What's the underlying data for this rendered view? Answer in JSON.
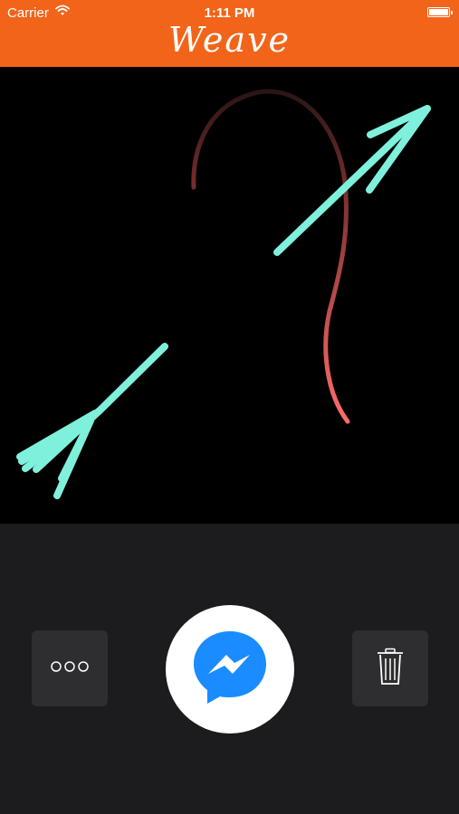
{
  "status_bar": {
    "carrier": "Carrier",
    "time": "1:11 PM"
  },
  "header": {
    "title": "Weave",
    "background_color": "#f26419"
  },
  "canvas": {
    "background_color": "#000000",
    "strokes": [
      {
        "name": "arrow-upper-right",
        "color": "#7ff0dc"
      },
      {
        "name": "arrow-lower-left",
        "color": "#7ff0dc"
      },
      {
        "name": "curve",
        "color_start": "#3a1a1a",
        "color_end": "#ff6b6b"
      }
    ]
  },
  "toolbar": {
    "more_icon": "more-dots-icon",
    "send_icon": "messenger-icon",
    "send_icon_color": "#1a8cff",
    "trash_icon": "trash-icon"
  }
}
